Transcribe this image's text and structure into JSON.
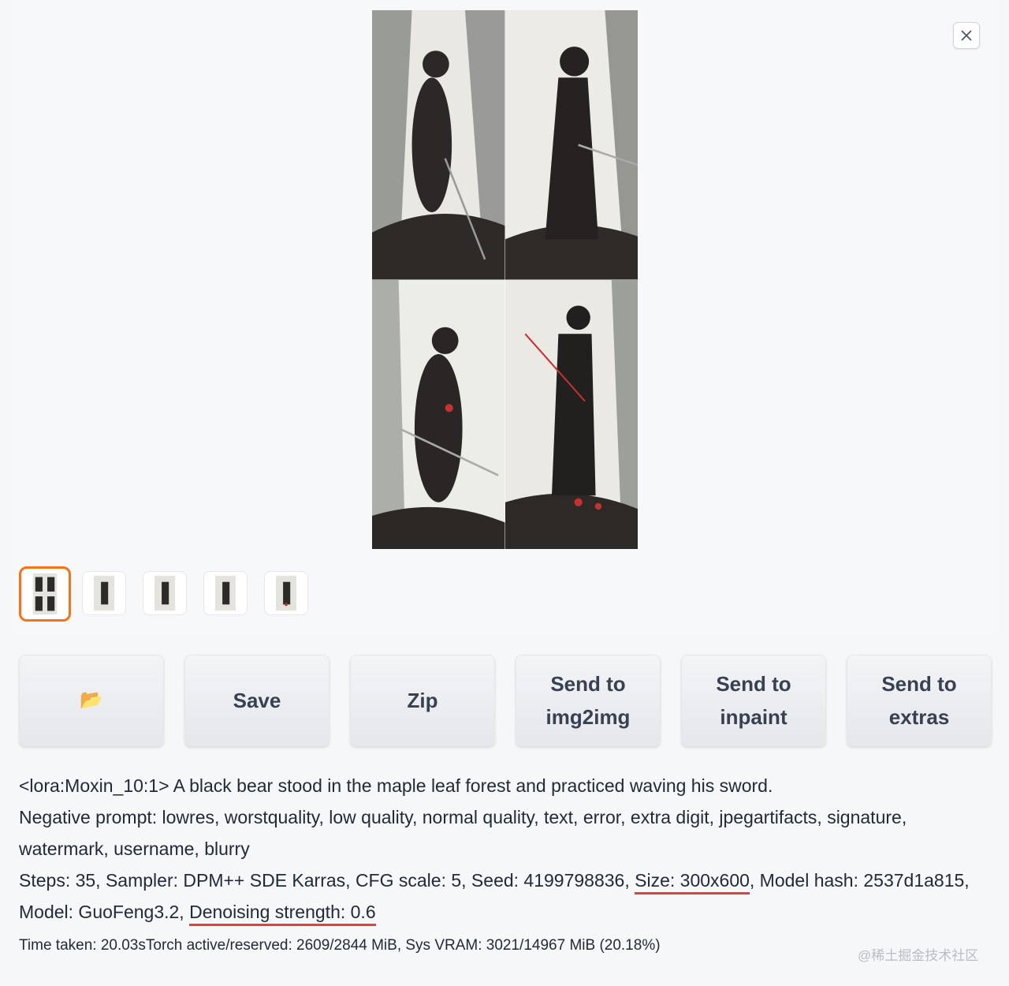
{
  "gallery": {
    "close_icon": "close-icon",
    "thumbnails": [
      {
        "name": "thumbnail-grid",
        "active": true
      },
      {
        "name": "thumbnail-1",
        "active": false
      },
      {
        "name": "thumbnail-2",
        "active": false
      },
      {
        "name": "thumbnail-3",
        "active": false
      },
      {
        "name": "thumbnail-4",
        "active": false
      }
    ]
  },
  "buttons": {
    "folder_icon": "folder-icon",
    "folder_glyph": "📂",
    "save": "Save",
    "zip": "Zip",
    "send_img2img": "Send to\nimg2img",
    "send_inpaint": "Send to\ninpaint",
    "send_extras": "Send to\nextras"
  },
  "generation_info": {
    "prompt": "<lora:Moxin_10:1> A black bear stood in the maple leaf forest and practiced waving his sword.",
    "negative_prompt": "Negative prompt: lowres, worstquality, low quality, normal quality, text, error, extra digit, jpegartifacts, signature, watermark, username, blurry",
    "params_part1": "Steps: 35, Sampler: DPM++ SDE Karras, CFG scale: 5, Seed: 4199798836, ",
    "size": "Size: 300x600",
    "params_part2": ", Model hash: 2537d1a815, Model: GuoFeng3.2, ",
    "denoising": "Denoising strength: 0.6",
    "time_taken": "Time taken: 20.03sTorch active/reserved: 2609/2844 MiB, Sys VRAM: 3021/14967 MiB (20.18%)"
  },
  "watermark": "@稀土掘金技术社区",
  "colors": {
    "accent": "#f97316",
    "underline": "#e53e3e"
  }
}
